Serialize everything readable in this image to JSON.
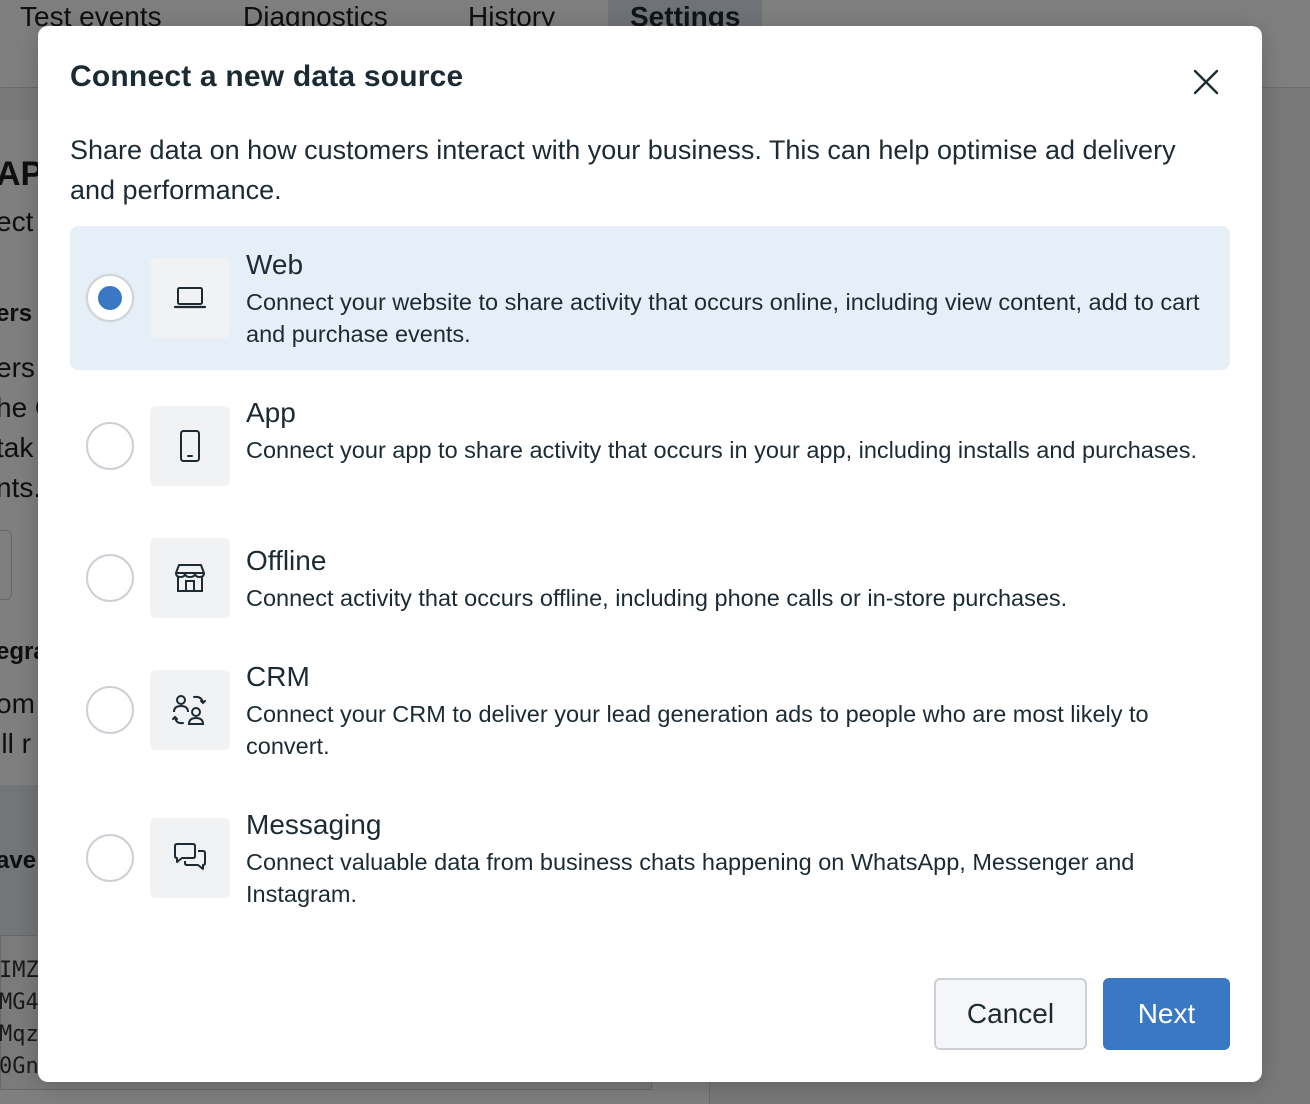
{
  "background": {
    "tabs": [
      "Test events",
      "Diagnostics",
      "History",
      "Settings"
    ],
    "active_tab": "Settings",
    "fragments": {
      "ap": "AP",
      "ect": "ect",
      "ers1": "ers",
      "ers2": "ers",
      "he": "he C",
      "tak": "tak",
      "nts": "nts.",
      "egra": "egra",
      "om": "om",
      "ll": "'ll r",
      "ave": "ave",
      "code1": "IMZ",
      "code2": "MG4",
      "code3": "Mqz",
      "code4": "0Gn"
    }
  },
  "modal": {
    "title": "Connect a new data source",
    "description": "Share data on how customers interact with your business. This can help optimise ad delivery and performance.",
    "options": [
      {
        "title": "Web",
        "description": "Connect your website to share activity that occurs online, including view content, add to cart and purchase events.",
        "icon": "laptop-icon",
        "selected": true
      },
      {
        "title": "App",
        "description": "Connect your app to share activity that occurs in your app, including installs and purchases.",
        "icon": "mobile-phone-icon",
        "selected": false
      },
      {
        "title": "Offline",
        "description": "Connect activity that occurs offline, including phone calls or in-store purchases.",
        "icon": "storefront-icon",
        "selected": false
      },
      {
        "title": "CRM",
        "description": "Connect your CRM to deliver your lead generation ads to people who are most likely to convert.",
        "icon": "people-sync-icon",
        "selected": false
      },
      {
        "title": "Messaging",
        "description": "Connect valuable data from business chats happening on WhatsApp, Messenger and Instagram.",
        "icon": "chat-bubbles-icon",
        "selected": false
      }
    ],
    "buttons": {
      "cancel_label": "Cancel",
      "next_label": "Next"
    }
  },
  "colors": {
    "primary": "#3a78c3",
    "selected_bg": "#e6eef7",
    "text": "#1c2b33",
    "overlay": "rgba(0,0,0,0.5)"
  }
}
